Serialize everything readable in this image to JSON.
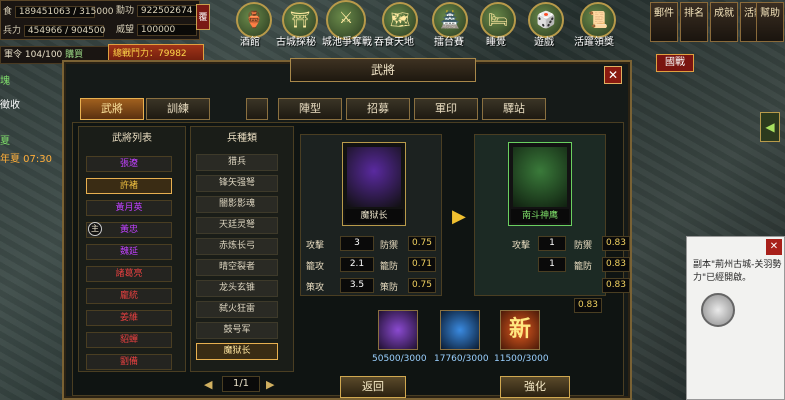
{
  "resources": {
    "food_label": "食",
    "food_value": "189451063 / 315000",
    "soldier_label": "兵力",
    "soldier_value": "454966 / 904500",
    "rank_label": "勳功",
    "rank_value": "922502674",
    "prestige_label": "威望",
    "prestige_value": "100000",
    "flag": "覆",
    "order_label": "軍令",
    "order_value": "104/100",
    "order_suffix": "購買",
    "power_label": "總戰鬥力：",
    "power_value": "79982"
  },
  "top_menu": [
    {
      "label": "酒館",
      "icon": "wine-jar-icon"
    },
    {
      "label": "古城探秘",
      "icon": "ancient-city-icon"
    },
    {
      "label": "城池爭奪戰",
      "icon": "city-battle-icon"
    },
    {
      "label": "吞食天地",
      "icon": "conquer-icon"
    },
    {
      "label": "擂台賽",
      "icon": "arena-icon"
    },
    {
      "label": "睡覺",
      "icon": "sleep-icon"
    },
    {
      "label": "遊戲",
      "icon": "dice-icon"
    },
    {
      "label": "活躍領獎",
      "icon": "reward-board-icon"
    }
  ],
  "side_buttons": [
    "郵件",
    "排名",
    "成就",
    "活動",
    "幫助"
  ],
  "guozhan": "國戰",
  "side_arrow": "◀",
  "left_strip": [
    "塊",
    "徵收",
    "夏",
    "年夏 07:30"
  ],
  "panel": {
    "title": "武將",
    "close": "✕",
    "tabs": [
      "武將",
      "訓練",
      "",
      "陣型",
      "招募",
      "軍印",
      "驛站"
    ],
    "general_list_title": "武將列表",
    "generals": [
      {
        "name": "張遼",
        "color": "#c040ff"
      },
      {
        "name": "許褚",
        "color": "#f0c040"
      },
      {
        "name": "黃月英",
        "color": "#c040ff"
      },
      {
        "name": "黃忠",
        "color": "#c040ff"
      },
      {
        "name": "魏延",
        "color": "#c040ff"
      },
      {
        "name": "諸葛亮",
        "color": "#e84040"
      },
      {
        "name": "龐統",
        "color": "#e84040"
      },
      {
        "name": "姜維",
        "color": "#e84040"
      },
      {
        "name": "貂蟬",
        "color": "#e84040"
      },
      {
        "name": "劉備",
        "color": "#e84040"
      }
    ],
    "lord_mark": "主",
    "unit_title": "兵種類",
    "units": [
      "猎兵",
      "锋矢强弩",
      "闇影影魂",
      "天廷灵弩",
      "赤炼长弓",
      "晴空裂者",
      "龙头玄锥",
      "弑火狂雷",
      "鼓号军",
      "魔狱长"
    ],
    "pager": "1/1",
    "card_left": "魔狱长",
    "card_right": "南斗神鹰",
    "stats_left": {
      "attack_label": "攻擊",
      "attack": "3",
      "phys_def_label": "防禦",
      "phys_def": "0.75",
      "strat_atk_label": "籠攻",
      "strat_atk": "2.1",
      "strat_def_label": "籠防",
      "strat_def": "0.71",
      "tactic_atk_label": "策攻",
      "tactic_atk": "3.5",
      "tactic_def_label": "策防",
      "tactic_def": "0.75"
    },
    "stats_right": {
      "attack": "1",
      "phys_def": "0.83",
      "strat_atk": "1",
      "strat_def": "0.83",
      "tactic_def": "0.83",
      "extra": "0.83"
    },
    "items": [
      {
        "label": "50500/3000",
        "icon": "purple-orb-icon"
      },
      {
        "label": "17760/3000",
        "icon": "blue-scroll-icon"
      },
      {
        "label": "11500/3000",
        "icon": "new-badge-icon",
        "badge": "新"
      }
    ],
    "back_button": "返回",
    "upgrade_button": "強化",
    "arrow": "▶"
  },
  "notice": {
    "text": "副本\"荊州古城-关羽勢力\"已經開啟。",
    "close": "✕"
  }
}
